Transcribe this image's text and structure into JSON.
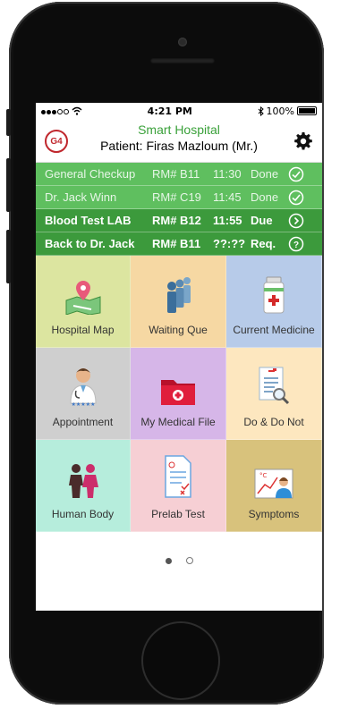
{
  "status_bar": {
    "time": "4:21 PM",
    "battery": "100%"
  },
  "header": {
    "logo": "G4",
    "app_title": "Smart Hospital",
    "patient": "Patient: Firas Mazloum (Mr.)",
    "settings_icon": "gear-icon"
  },
  "schedule": [
    {
      "name": "General Checkup",
      "room": "RM# B11",
      "time": "11:30",
      "status": "Done",
      "icon": "check-circle-icon"
    },
    {
      "name": "Dr. Jack Winn",
      "room": "RM# C19",
      "time": "11:45",
      "status": "Done",
      "icon": "check-circle-icon"
    },
    {
      "name": "Blood Test LAB",
      "room": "RM# B12",
      "time": "11:55",
      "status": "Due",
      "icon": "chevron-circle-icon"
    },
    {
      "name": "Back to Dr. Jack",
      "room": "RM# B11",
      "time": "??:??",
      "status": "Req.",
      "icon": "question-circle-icon"
    }
  ],
  "tiles": [
    {
      "label": "Hospital Map",
      "color": "#dce5a0",
      "icon": "map-pin-icon"
    },
    {
      "label": "Waiting Que",
      "color": "#f6d8a3",
      "icon": "people-queue-icon"
    },
    {
      "label": "Current Medicine",
      "color": "#b7cbe9",
      "icon": "medicine-bottle-icon"
    },
    {
      "label": "Appointment",
      "color": "#cfcfcf",
      "icon": "doctor-icon"
    },
    {
      "label": "My Medical File",
      "color": "#d6b6e8",
      "icon": "medical-folder-icon"
    },
    {
      "label": "Do & Do Not",
      "color": "#fde7bf",
      "icon": "checklist-search-icon"
    },
    {
      "label": "Human Body",
      "color": "#b6eddc",
      "icon": "human-body-icon"
    },
    {
      "label": "Prelab Test",
      "color": "#f6cfd4",
      "icon": "lab-report-icon"
    },
    {
      "label": "Symptoms",
      "color": "#d8c27c",
      "icon": "fever-chart-icon"
    }
  ],
  "pager": {
    "pages": 2,
    "current": 1
  }
}
